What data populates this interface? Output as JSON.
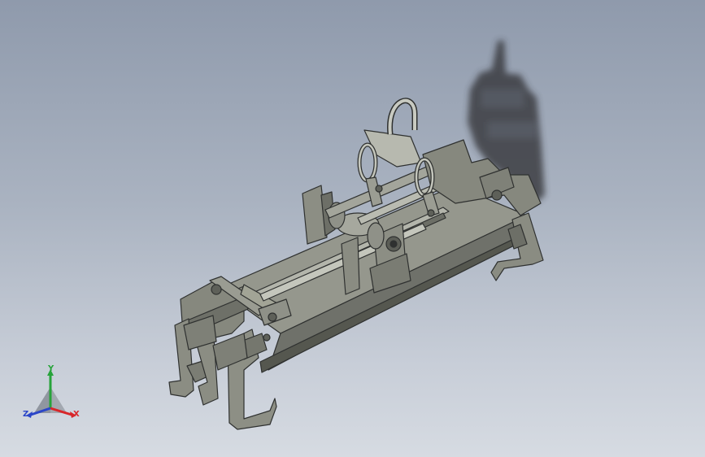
{
  "viewport": {
    "background_top": "#8f9aac",
    "background_bottom": "#d6dbe2"
  },
  "model": {
    "description_icon": "spreader-beam-lifting-gripper-model",
    "body_color": "#8f9186",
    "edge_color": "#2f3130",
    "shadow_color": "#2d2f33"
  },
  "triad": {
    "x_label": "X",
    "y_label": "Y",
    "z_label": "Z",
    "x_color": "#d8262a",
    "y_color": "#27a33a",
    "z_color": "#2b46c8"
  }
}
